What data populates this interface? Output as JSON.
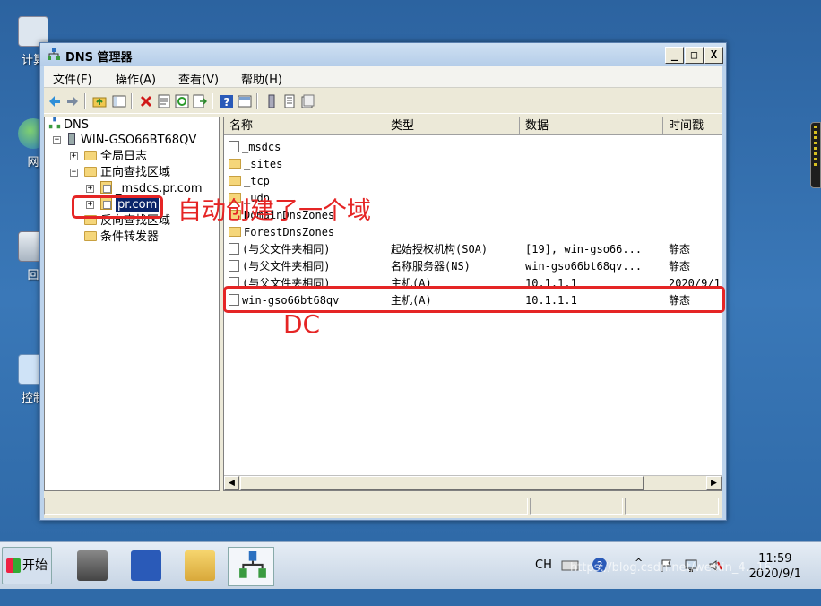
{
  "desktop": {
    "icons": [
      {
        "label": "计算",
        "name": "computer"
      },
      {
        "label": "网",
        "name": "network"
      },
      {
        "label": "回",
        "name": "recycle-bin"
      },
      {
        "label": "控制",
        "name": "control-panel"
      }
    ]
  },
  "window": {
    "title": "DNS 管理器",
    "menu": [
      "文件(F)",
      "操作(A)",
      "查看(V)",
      "帮助(H)"
    ],
    "caption_buttons": {
      "minimize": "_",
      "maximize": "□",
      "close": "X"
    }
  },
  "tree": {
    "root": "DNS",
    "server": "WIN-GSO66BT68QV",
    "items": [
      {
        "label": "全局日志"
      },
      {
        "label": "正向查找区域"
      },
      {
        "label": "_msdcs.pr.com"
      },
      {
        "label": "pr.com"
      },
      {
        "label": "反向查找区域"
      },
      {
        "label": "条件转发器"
      }
    ]
  },
  "list": {
    "columns": [
      "名称",
      "类型",
      "数据",
      "时间戳"
    ],
    "rows": [
      {
        "name": "_msdcs",
        "type": "",
        "data": "",
        "time": "",
        "icon": "zone"
      },
      {
        "name": "_sites",
        "type": "",
        "data": "",
        "time": "",
        "icon": "folder"
      },
      {
        "name": "_tcp",
        "type": "",
        "data": "",
        "time": "",
        "icon": "folder"
      },
      {
        "name": "_udp",
        "type": "",
        "data": "",
        "time": "",
        "icon": "folder"
      },
      {
        "name": "DomainDnsZones",
        "type": "",
        "data": "",
        "time": "",
        "icon": "folder"
      },
      {
        "name": "ForestDnsZones",
        "type": "",
        "data": "",
        "time": "",
        "icon": "folder"
      },
      {
        "name": "(与父文件夹相同)",
        "type": "起始授权机构(SOA)",
        "data": "[19], win-gso66...",
        "time": "静态",
        "icon": "record"
      },
      {
        "name": "(与父文件夹相同)",
        "type": "名称服务器(NS)",
        "data": "win-gso66bt68qv...",
        "time": "静态",
        "icon": "record"
      },
      {
        "name": "(与父文件夹相同)",
        "type": "主机(A)",
        "data": "10.1.1.1",
        "time": "2020/9/1",
        "icon": "record"
      },
      {
        "name": "win-gso66bt68qv",
        "type": "主机(A)",
        "data": "10.1.1.1",
        "time": "静态",
        "icon": "record"
      }
    ]
  },
  "annotations": {
    "auto_domain": "自动创建了一个域",
    "dc": "DC"
  },
  "taskbar": {
    "start": "开始",
    "lang": "CH",
    "time": "11:59",
    "date": "2020/9/1",
    "watermark": "https://blog.csdn.net/weixin_4...16"
  },
  "colors": {
    "annotation": "#e52525",
    "selection": "#0a246a"
  }
}
